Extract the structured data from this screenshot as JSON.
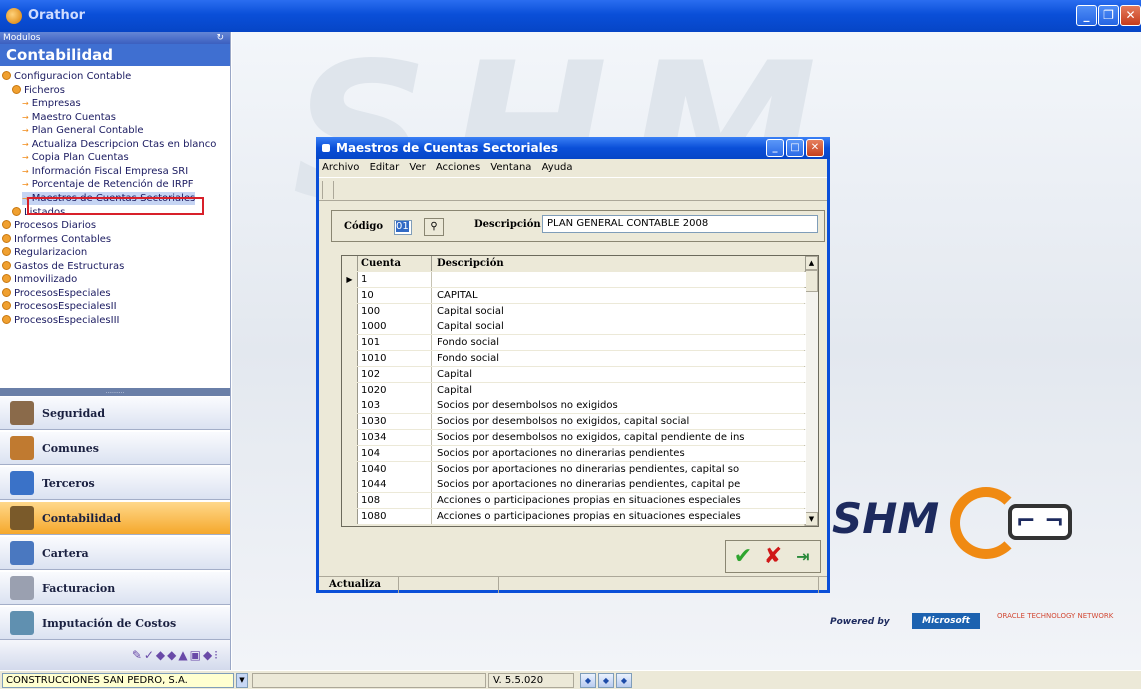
{
  "app": {
    "title": "Orathor"
  },
  "left_panel": {
    "modulos_label": "Modulos",
    "section_title": "Contabilidad",
    "tree": [
      {
        "label": "Configuracion Contable",
        "level": 0,
        "kind": "folder"
      },
      {
        "label": "Ficheros",
        "level": 1,
        "kind": "folder"
      },
      {
        "label": "Empresas",
        "level": 2,
        "kind": "leaf"
      },
      {
        "label": "Maestro Cuentas",
        "level": 2,
        "kind": "leaf"
      },
      {
        "label": "Plan General Contable",
        "level": 2,
        "kind": "leaf"
      },
      {
        "label": "Actualiza Descripcion Ctas en blanco",
        "level": 2,
        "kind": "leaf"
      },
      {
        "label": "Copia Plan Cuentas",
        "level": 2,
        "kind": "leaf"
      },
      {
        "label": "Información Fiscal Empresa SRI",
        "level": 2,
        "kind": "leaf"
      },
      {
        "label": "Porcentaje de Retención de IRPF",
        "level": 2,
        "kind": "leaf"
      },
      {
        "label": "Maestros de Cuentas Sectoriales",
        "level": 2,
        "kind": "leaf",
        "highlighted": true
      },
      {
        "label": "Listados",
        "level": 1,
        "kind": "folder"
      },
      {
        "label": "Procesos Diarios",
        "level": 0,
        "kind": "folder"
      },
      {
        "label": "Informes Contables",
        "level": 0,
        "kind": "folder"
      },
      {
        "label": "Regularizacion",
        "level": 0,
        "kind": "folder"
      },
      {
        "label": "Gastos de Estructuras",
        "level": 0,
        "kind": "folder"
      },
      {
        "label": "Inmovilizado",
        "level": 0,
        "kind": "folder"
      },
      {
        "label": "ProcesosEspeciales",
        "level": 0,
        "kind": "folder"
      },
      {
        "label": "ProcesosEspecialesII",
        "level": 0,
        "kind": "folder"
      },
      {
        "label": "ProcesosEspecialesIII",
        "level": 0,
        "kind": "folder"
      }
    ],
    "grip_label": "..........",
    "modules": [
      {
        "label": "Seguridad",
        "icon": "seguridad-icon",
        "color": "#8a6a4a"
      },
      {
        "label": "Comunes",
        "icon": "comunes-icon",
        "color": "#c07a30"
      },
      {
        "label": "Terceros",
        "icon": "terceros-icon",
        "color": "#3a72c8"
      },
      {
        "label": "Contabilidad",
        "icon": "contabilidad-icon",
        "color": "#7a5a2a",
        "active": true
      },
      {
        "label": "Cartera",
        "icon": "cartera-icon",
        "color": "#4a78c0"
      },
      {
        "label": "Facturacion",
        "icon": "facturacion-icon",
        "color": "#9aa0b0"
      },
      {
        "label": "Imputación de Costos",
        "icon": "imputacion-icon",
        "color": "#6090b0"
      }
    ],
    "icon_strip": "✎✓◆◆▲▣◆⁝"
  },
  "background": {
    "watermark": "SHM",
    "brand": "SHM",
    "brand_mark": "⌐ ¬",
    "powered_by": "Powered by",
    "microsoft": "Microsoft",
    "oracle": "ORACLE TECHNOLOGY NETWORK"
  },
  "dialog": {
    "title": "Maestros de Cuentas Sectoriales",
    "menu": [
      "Archivo",
      "Editar",
      "Ver",
      "Acciones",
      "Ventana",
      "Ayuda"
    ],
    "codigo_label": "Código",
    "codigo_value": "01",
    "descripcion_label": "Descripción",
    "descripcion_value": "PLAN GENERAL CONTABLE 2008",
    "grid": {
      "headers": [
        "Cuenta",
        "Descripción"
      ],
      "rows": [
        {
          "cuenta": "1",
          "descripcion": ""
        },
        {
          "cuenta": "10",
          "descripcion": "CAPITAL"
        },
        {
          "cuenta": "100",
          "descripcion": "Capital social"
        },
        {
          "cuenta": "1000",
          "descripcion": "Capital social"
        },
        {
          "cuenta": "101",
          "descripcion": "Fondo social"
        },
        {
          "cuenta": "1010",
          "descripcion": "Fondo social"
        },
        {
          "cuenta": "102",
          "descripcion": "Capital"
        },
        {
          "cuenta": "1020",
          "descripcion": "Capital"
        },
        {
          "cuenta": "103",
          "descripcion": "Socios por desembolsos no exigidos"
        },
        {
          "cuenta": "1030",
          "descripcion": "Socios por desembolsos no exigidos, capital social"
        },
        {
          "cuenta": "1034",
          "descripcion": "Socios por desembolsos no exigidos, capital pendiente de ins"
        },
        {
          "cuenta": "104",
          "descripcion": "Socios por aportaciones no dinerarias pendientes"
        },
        {
          "cuenta": "1040",
          "descripcion": "Socios por aportaciones no dinerarias pendientes, capital so"
        },
        {
          "cuenta": "1044",
          "descripcion": "Socios por aportaciones no dinerarias pendientes, capital pe"
        },
        {
          "cuenta": "108",
          "descripcion": "Acciones o participaciones propias en situaciones especiales"
        },
        {
          "cuenta": "1080",
          "descripcion": "Acciones o participaciones propias en situaciones especiales"
        }
      ]
    },
    "status_label": "Actualiza"
  },
  "bottom": {
    "company": "CONSTRUCCIONES SAN PEDRO, S.A.",
    "version": "V. 5.5.020"
  }
}
